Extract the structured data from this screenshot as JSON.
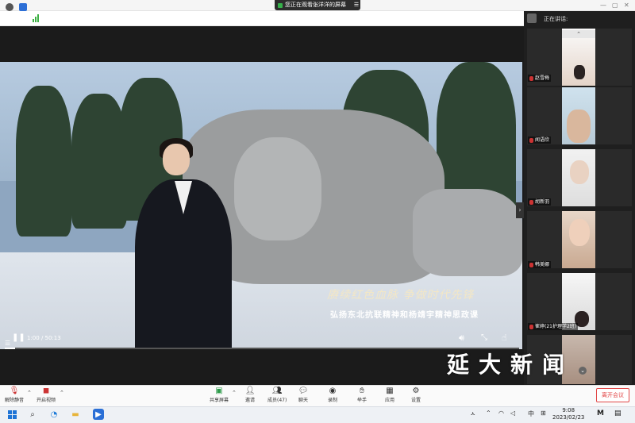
{
  "banner": {
    "text": "您正在观看张洋洋的屏幕",
    "menu_icon": "menu-icon"
  },
  "video": {
    "caption_line1": "赓续红色血脉 争做时代先锋",
    "caption_line2": "弘扬东北抗联精神和杨靖宇精神思政课",
    "time": "1:00 / 50:13",
    "progress_fraction": 0.02
  },
  "sidebar": {
    "speaking_label": "正在讲话:",
    "participants": [
      {
        "name": "赵雪梅"
      },
      {
        "name": "闻语欣"
      },
      {
        "name": "胡新羽"
      },
      {
        "name": "韩美娜"
      },
      {
        "name": "崔婷(21护理学2班)"
      },
      {
        "name": ""
      }
    ]
  },
  "meeting_bar": {
    "items": [
      {
        "label": "解除静音",
        "icon": "mic-off-icon"
      },
      {
        "label": "开启视频",
        "icon": "video-off-icon"
      },
      {
        "label": "共享屏幕",
        "icon": "share-screen-icon"
      },
      {
        "label": "邀请",
        "icon": "invite-icon"
      },
      {
        "label": "成员(47)",
        "icon": "members-icon"
      },
      {
        "label": "聊天",
        "icon": "chat-icon"
      },
      {
        "label": "录制",
        "icon": "record-icon"
      },
      {
        "label": "举手",
        "icon": "hand-icon"
      },
      {
        "label": "应用",
        "icon": "apps-icon"
      },
      {
        "label": "设置",
        "icon": "settings-icon"
      }
    ],
    "leave_label": "离开会议"
  },
  "taskbar": {
    "time": "9:08",
    "date": "2023/02/23",
    "ime": "中"
  },
  "watermark": "延大新闻",
  "colors": {
    "leave": "#e24848",
    "mic_muted": "#cc3333",
    "banner": "#2d2d2d"
  }
}
